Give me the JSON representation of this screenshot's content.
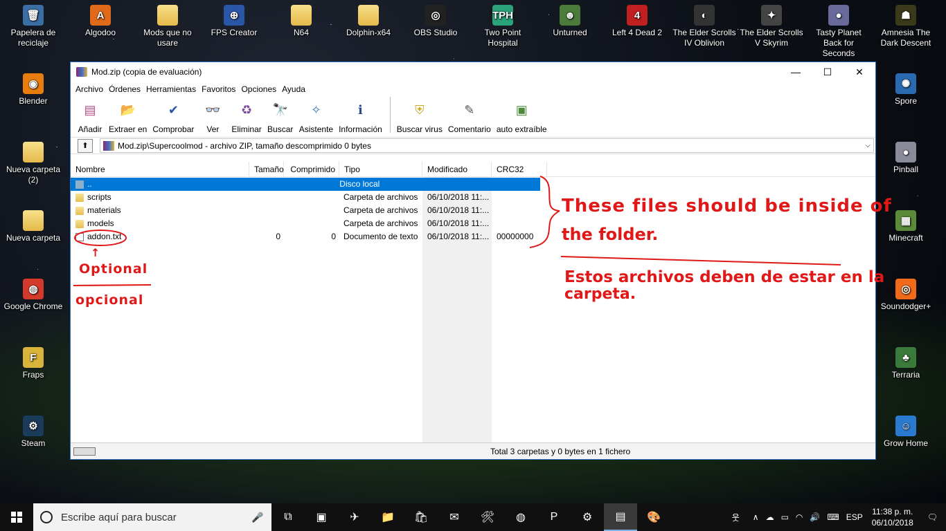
{
  "desktop": {
    "icons_top": [
      {
        "label": "Papelera de reciclaje",
        "icon": "recycle-bin-icon",
        "glyph": "🗑",
        "color": "#3a6ea5"
      },
      {
        "label": "Algodoo",
        "icon": "algodoo-icon",
        "glyph": "A",
        "color": "#e06a1a"
      },
      {
        "label": "Mods que no usare",
        "icon": "folder-icon",
        "glyph": "",
        "color": "folder"
      },
      {
        "label": "FPS Creator",
        "icon": "fps-creator-icon",
        "glyph": "⊕",
        "color": "#2a56a8"
      },
      {
        "label": "N64",
        "icon": "folder-icon",
        "glyph": "",
        "color": "folder"
      },
      {
        "label": "Dolphin-x64",
        "icon": "folder-icon",
        "glyph": "",
        "color": "folder"
      },
      {
        "label": "OBS Studio",
        "icon": "obs-icon",
        "glyph": "◎",
        "color": "#222222"
      },
      {
        "label": "Two Point Hospital",
        "icon": "two-point-hospital-icon",
        "glyph": "TPH",
        "color": "#2aa37a"
      },
      {
        "label": "Unturned",
        "icon": "unturned-icon",
        "glyph": "☻",
        "color": "#4c7a3a"
      },
      {
        "label": "Left 4 Dead 2",
        "icon": "left-4-dead-icon",
        "glyph": "4",
        "color": "#c02020"
      },
      {
        "label": "The Elder Scrolls IV Oblivion",
        "icon": "oblivion-icon",
        "glyph": "◐",
        "color": "#333333"
      },
      {
        "label": "The Elder Scrolls V Skyrim",
        "icon": "skyrim-icon",
        "glyph": "✦",
        "color": "#444444"
      },
      {
        "label": "Tasty Planet Back for Seconds",
        "icon": "tasty-planet-icon",
        "glyph": "●",
        "color": "#6a6a9a"
      },
      {
        "label": "Amnesia The Dark Descent",
        "icon": "amnesia-icon",
        "glyph": "☗",
        "color": "#3a3a1a"
      }
    ],
    "icons_left": [
      {
        "label": "Blender",
        "icon": "blender-icon",
        "glyph": "◉",
        "color": "#e87d0d"
      },
      {
        "label": "Nueva carpeta (2)",
        "icon": "folder-icon",
        "glyph": "",
        "color": "folder"
      },
      {
        "label": "Nueva carpeta",
        "icon": "folder-icon",
        "glyph": "",
        "color": "folder"
      },
      {
        "label": "Google Chrome",
        "icon": "chrome-icon",
        "glyph": "◍",
        "color": "#d33a2c"
      },
      {
        "label": "Fraps",
        "icon": "fraps-icon",
        "glyph": "F",
        "color": "#d8b43a"
      },
      {
        "label": "Steam",
        "icon": "steam-icon",
        "glyph": "⚙",
        "color": "#1b3b5a"
      }
    ],
    "icons_right": [
      {
        "label": "Spore",
        "icon": "spore-icon",
        "glyph": "✺",
        "color": "#2a6ab0"
      },
      {
        "label": "Pinball",
        "icon": "pinball-icon",
        "glyph": "●",
        "color": "#8a8a9a"
      },
      {
        "label": "Minecraft",
        "icon": "minecraft-icon",
        "glyph": "▦",
        "color": "#5a8a3a"
      },
      {
        "label": "Soundodger+",
        "icon": "soundodger-icon",
        "glyph": "◎",
        "color": "#f06a1a"
      },
      {
        "label": "Terraria",
        "icon": "terraria-icon",
        "glyph": "♣",
        "color": "#3a7a3a"
      },
      {
        "label": "Grow Home",
        "icon": "grow-home-icon",
        "glyph": "☺",
        "color": "#2a7ad0"
      }
    ]
  },
  "window": {
    "title": "Mod.zip (copia de evaluación)",
    "controls": {
      "minimize": "—",
      "maximize": "☐",
      "close": "✕"
    },
    "menu": [
      "Archivo",
      "Órdenes",
      "Herramientas",
      "Favoritos",
      "Opciones",
      "Ayuda"
    ],
    "toolbar_left": [
      {
        "label": "Añadir",
        "icon": "add-archive-icon",
        "glyph": "▤"
      },
      {
        "label": "Extraer en",
        "icon": "extract-icon",
        "glyph": "📂"
      },
      {
        "label": "Comprobar",
        "icon": "test-icon",
        "glyph": "✔"
      },
      {
        "label": "Ver",
        "icon": "view-icon",
        "glyph": "👓"
      },
      {
        "label": "Eliminar",
        "icon": "delete-icon",
        "glyph": "♻"
      },
      {
        "label": "Buscar",
        "icon": "find-icon",
        "glyph": "🔭"
      },
      {
        "label": "Asistente",
        "icon": "wizard-icon",
        "glyph": "✧"
      },
      {
        "label": "Información",
        "icon": "info-icon",
        "glyph": "ℹ"
      }
    ],
    "toolbar_right": [
      {
        "label": "Buscar virus",
        "icon": "virus-scan-icon",
        "glyph": "⛨"
      },
      {
        "label": "Comentario",
        "icon": "comment-icon",
        "glyph": "✎"
      },
      {
        "label": "auto extraíble",
        "icon": "sfx-icon",
        "glyph": "▣"
      }
    ],
    "address": "Mod.zip\\Supercoolmod - archivo ZIP, tamaño descomprimido 0 bytes",
    "columns": [
      "Nombre",
      "Tamaño",
      "Comprimido",
      "Tipo",
      "Modificado",
      "CRC32"
    ],
    "rows": [
      {
        "name": "..",
        "size": "",
        "packed": "",
        "type": "Disco local",
        "modified": "",
        "crc": "",
        "kind": "up",
        "selected": true
      },
      {
        "name": "scripts",
        "size": "",
        "packed": "",
        "type": "Carpeta de archivos",
        "modified": "06/10/2018 11:...",
        "crc": "",
        "kind": "fold",
        "selected": false
      },
      {
        "name": "materials",
        "size": "",
        "packed": "",
        "type": "Carpeta de archivos",
        "modified": "06/10/2018 11:...",
        "crc": "",
        "kind": "fold",
        "selected": false
      },
      {
        "name": "models",
        "size": "",
        "packed": "",
        "type": "Carpeta de archivos",
        "modified": "06/10/2018 11:...",
        "crc": "",
        "kind": "fold",
        "selected": false
      },
      {
        "name": "addon.txt",
        "size": "0",
        "packed": "0",
        "type": "Documento de texto",
        "modified": "06/10/2018 11:...",
        "crc": "00000000",
        "kind": "doc",
        "selected": false
      }
    ],
    "status": "Total 3 carpetas y 0 bytes en 1 fichero"
  },
  "annotations": {
    "note_en_line1": "These files should be inside of",
    "note_en_line2": "the folder.",
    "note_es_line1": "Estos archivos deben de estar en la",
    "note_es_line2": "carpeta.",
    "optional_en": "Optional",
    "optional_es": "opcional",
    "arrow": "↑",
    "color": "#e01818"
  },
  "taskbar": {
    "search_placeholder": "Escribe aquí para buscar",
    "apps": [
      {
        "icon": "task-view-icon",
        "glyph": "⧉"
      },
      {
        "icon": "remote-desktop-icon",
        "glyph": "▣"
      },
      {
        "icon": "bird-app-icon",
        "glyph": "✈"
      },
      {
        "icon": "file-explorer-icon",
        "glyph": "📁"
      },
      {
        "icon": "store-icon",
        "glyph": "🛍"
      },
      {
        "icon": "mail-icon",
        "glyph": "✉"
      },
      {
        "icon": "tool-app-icon",
        "glyph": "🛠"
      },
      {
        "icon": "chrome-icon",
        "glyph": "◍"
      },
      {
        "icon": "powerpoint-icon",
        "glyph": "P"
      },
      {
        "icon": "steam-icon",
        "glyph": "⚙"
      },
      {
        "icon": "winrar-icon",
        "glyph": "▤",
        "active": true
      },
      {
        "icon": "paint-icon",
        "glyph": "🎨"
      }
    ],
    "tray": {
      "people": "웃",
      "chevron": "∧",
      "cloud": "☁",
      "network": "▭",
      "wifi": "◠",
      "volume": "🔊",
      "keyboard": "⌨",
      "lang": "ESP",
      "time": "11:38 p. m.",
      "date": "06/10/2018",
      "notif": "🗨"
    }
  }
}
